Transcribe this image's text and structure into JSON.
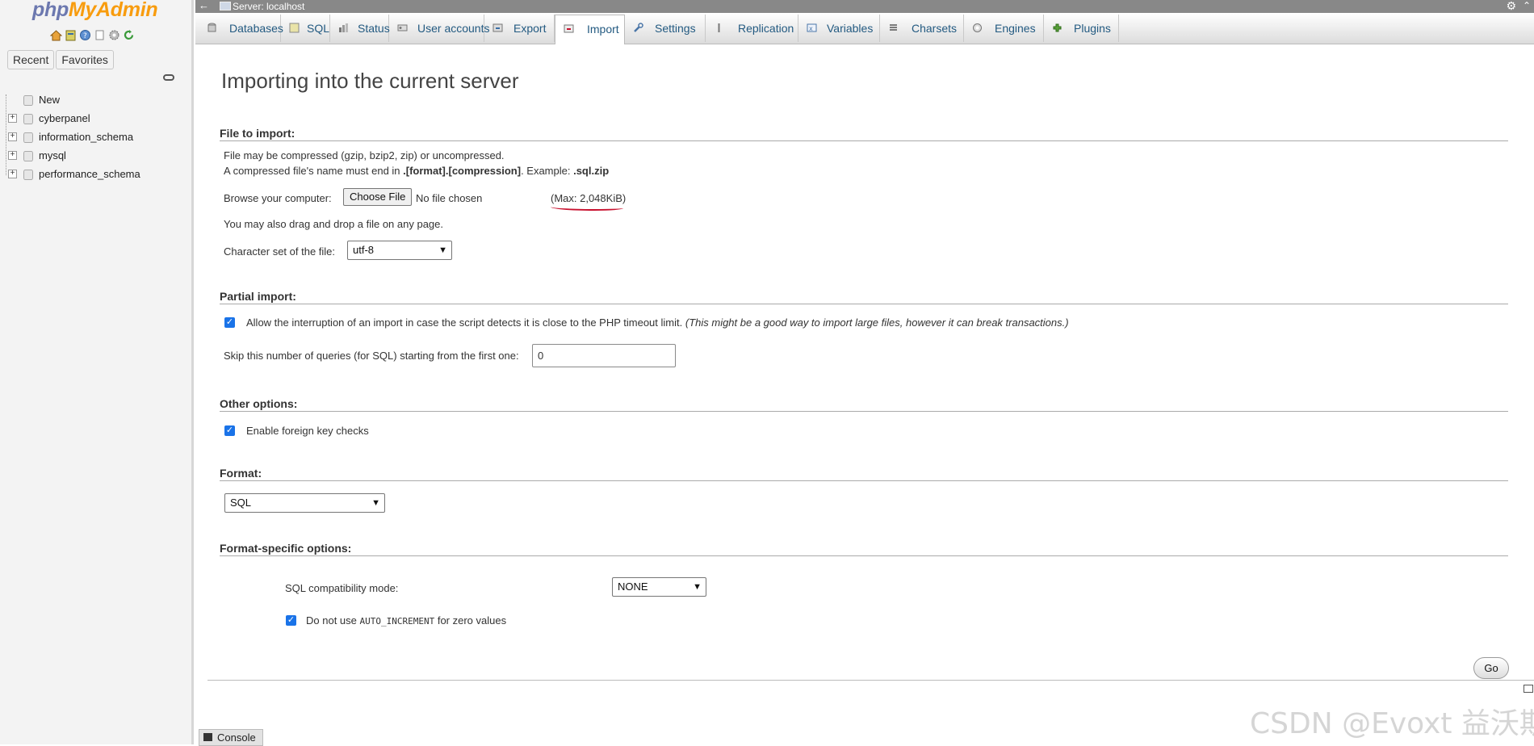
{
  "logo": {
    "part1": "php",
    "part2": "MyAdmin"
  },
  "nav": {
    "tabs": [
      "Recent",
      "Favorites"
    ],
    "icons": [
      "home-icon",
      "sql-icon",
      "help-icon",
      "docs-icon",
      "settings-icon",
      "reload-icon"
    ],
    "tree": [
      {
        "label": "New",
        "expandable": false
      },
      {
        "label": "cyberpanel",
        "expandable": true
      },
      {
        "label": "information_schema",
        "expandable": true
      },
      {
        "label": "mysql",
        "expandable": true
      },
      {
        "label": "performance_schema",
        "expandable": true
      }
    ]
  },
  "topbar": {
    "server": "Server: localhost"
  },
  "tabs": [
    {
      "label": "Databases",
      "icon": "database-icon"
    },
    {
      "label": "SQL",
      "icon": "sql-icon"
    },
    {
      "label": "Status",
      "icon": "status-icon"
    },
    {
      "label": "User accounts",
      "icon": "users-icon"
    },
    {
      "label": "Export",
      "icon": "export-icon"
    },
    {
      "label": "Import",
      "icon": "import-icon",
      "active": true
    },
    {
      "label": "Settings",
      "icon": "wrench-icon"
    },
    {
      "label": "Replication",
      "icon": "replication-icon"
    },
    {
      "label": "Variables",
      "icon": "variables-icon"
    },
    {
      "label": "Charsets",
      "icon": "charsets-icon"
    },
    {
      "label": "Engines",
      "icon": "engines-icon"
    },
    {
      "label": "Plugins",
      "icon": "plugins-icon"
    }
  ],
  "page": {
    "title": "Importing into the current server"
  },
  "file_import": {
    "legend": "File to import:",
    "line1": "File may be compressed (gzip, bzip2, zip) or uncompressed.",
    "line2_pre": "A compressed file's name must end in ",
    "line2_bold": ".[format].[compression]",
    "line2_mid": ". Example: ",
    "line2_example": ".sql.zip",
    "browse_label": "Browse your computer:",
    "choose_button": "Choose File",
    "no_file": "No file chosen",
    "max_size": "(Max: 2,048KiB)",
    "drag_drop": "You may also drag and drop a file on any page.",
    "charset_label": "Character set of the file:",
    "charset_value": "utf-8"
  },
  "partial_import": {
    "legend": "Partial import:",
    "allow_interrupt_label": "Allow the interruption of an import in case the script detects it is close to the PHP timeout limit.",
    "allow_interrupt_note": "(This might be a good way to import large files, however it can break transactions.)",
    "allow_interrupt_checked": true,
    "skip_label": "Skip this number of queries (for SQL) starting from the first one:",
    "skip_value": "0"
  },
  "other_options": {
    "legend": "Other options:",
    "fk_label": "Enable foreign key checks",
    "fk_checked": true
  },
  "format": {
    "legend": "Format:",
    "value": "SQL"
  },
  "format_specific": {
    "legend": "Format-specific options:",
    "compat_label": "SQL compatibility mode:",
    "compat_value": "NONE",
    "auto_inc_pre": "Do not use ",
    "auto_inc_code": "AUTO_INCREMENT",
    "auto_inc_post": " for zero values",
    "auto_inc_checked": true
  },
  "go_button": "Go",
  "console_label": "Console",
  "watermark": "CSDN @Evoxt 益沃斯",
  "colors": {
    "link": "#235a81",
    "checkbox": "#1a73e8",
    "underline": "#c8102e"
  }
}
